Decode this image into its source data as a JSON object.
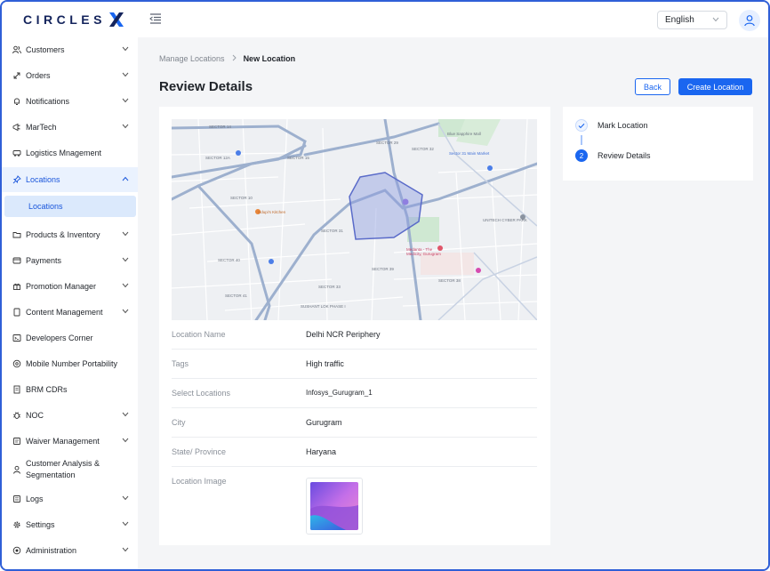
{
  "header": {
    "logo_text": "CIRCLES",
    "language": "English"
  },
  "sidebar": {
    "items": [
      {
        "label": "Customers",
        "icon": "customers-icon",
        "chevron": true
      },
      {
        "label": "Orders",
        "icon": "orders-icon",
        "chevron": true
      },
      {
        "label": "Notifications",
        "icon": "bell-icon",
        "chevron": true
      },
      {
        "label": "MarTech",
        "icon": "martech-icon",
        "chevron": true
      },
      {
        "label": "Logistics Mnagement",
        "icon": "truck-icon",
        "chevron": false
      },
      {
        "label": "Locations",
        "icon": "pin-icon",
        "chevron": true
      },
      {
        "label": "Products & Inventory",
        "icon": "folder-icon",
        "chevron": true
      },
      {
        "label": "Payments",
        "icon": "card-icon",
        "chevron": true
      },
      {
        "label": "Promotion Manager",
        "icon": "promotion-icon",
        "chevron": true
      },
      {
        "label": "Content Management",
        "icon": "content-icon",
        "chevron": true
      },
      {
        "label": "Developers Corner",
        "icon": "terminal-icon",
        "chevron": false
      },
      {
        "label": "Mobile Number Portability",
        "icon": "portability-icon",
        "chevron": false
      },
      {
        "label": "BRM CDRs",
        "icon": "document-icon",
        "chevron": false
      },
      {
        "label": "NOC",
        "icon": "bug-icon",
        "chevron": true
      },
      {
        "label": "Waiver Management",
        "icon": "waiver-icon",
        "chevron": true
      },
      {
        "label": "Customer Analysis & Segmentation",
        "icon": "user-icon",
        "chevron": false
      },
      {
        "label": "Logs",
        "icon": "logs-icon",
        "chevron": true
      },
      {
        "label": "Settings",
        "icon": "gear-icon",
        "chevron": true
      },
      {
        "label": "Administration",
        "icon": "admin-icon",
        "chevron": true
      }
    ],
    "active_sub_item": "Locations"
  },
  "breadcrumb": {
    "parent": "Manage Locations",
    "current": "New Location"
  },
  "page": {
    "title": "Review Details",
    "back_label": "Back",
    "create_label": "Create Location"
  },
  "details": [
    {
      "label": "Location Name",
      "value": "Delhi NCR Periphery"
    },
    {
      "label": "Tags",
      "value": "High traffic"
    },
    {
      "label": "Select Locations",
      "value": "Infosys_Gurugram_1"
    },
    {
      "label": "City",
      "value": "Gurugram"
    },
    {
      "label": "State/ Province",
      "value": "Haryana"
    },
    {
      "label": "Location Image",
      "value": ""
    }
  ],
  "map": {
    "labels": [
      "Blue Sapphire Mall",
      "Sector 31 Main Market",
      "UNITECH CYBER PARK",
      "Medanta - The Medicity, Gurugram",
      "Udupi's Kitchen",
      "SECTOR 14",
      "SECTOR 15",
      "SECTOR 29",
      "SECTOR 31",
      "SECTOR 32",
      "SECTOR 33",
      "SECTOR 12A",
      "SECTOR 10",
      "SECTOR 39",
      "SECTOR 40",
      "SECTOR 41",
      "SECTOR 38",
      "SUSHANT LOK PHASE I"
    ],
    "colors": {
      "polygon_fill": "#8f9ee0",
      "polygon_stroke": "#5a6bc9",
      "road": "#8ea4c8",
      "park": "#bfe3c4"
    }
  },
  "steps": [
    {
      "label": "Mark Location",
      "status": "done"
    },
    {
      "label": "Review Details",
      "status": "current",
      "number": "2"
    }
  ],
  "colors": {
    "accent": "#1a66f0",
    "brand": "#14245c",
    "active_bg": "#eaf2fe"
  }
}
